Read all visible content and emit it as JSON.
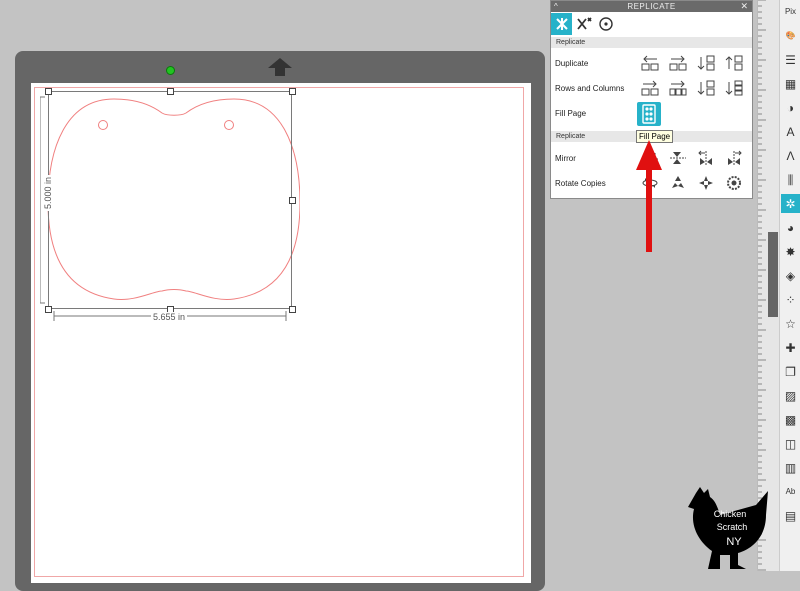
{
  "panel": {
    "title": "REPLICATE",
    "collapse_glyph": "^",
    "close_glyph": "✕",
    "tabs": [
      {
        "name": "replicate-icon",
        "active": true
      },
      {
        "name": "wand-icon",
        "active": false
      },
      {
        "name": "target-icon",
        "active": false
      }
    ],
    "section1": "Replicate",
    "section2": "Replicate",
    "rows": [
      {
        "label": "Duplicate"
      },
      {
        "label": "Rows and Columns"
      },
      {
        "label": "Fill Page"
      },
      {
        "label": "Mirror"
      },
      {
        "label": "Rotate Copies"
      }
    ],
    "tooltip": "Fill Page"
  },
  "selection": {
    "width_label": "5.655 in",
    "height_label": "5.000 in"
  },
  "toolbar": {
    "buttons": [
      {
        "name": "pix-icon",
        "glyph": "Pix"
      },
      {
        "name": "palette-icon",
        "glyph": "🎨"
      },
      {
        "name": "line-style-icon",
        "glyph": "☰"
      },
      {
        "name": "fill-pattern-icon",
        "glyph": "▦"
      },
      {
        "name": "transparency-icon",
        "glyph": "◑"
      },
      {
        "name": "text-icon",
        "glyph": "A"
      },
      {
        "name": "text-path-icon",
        "glyph": "Λ"
      },
      {
        "name": "align-icon",
        "glyph": "⫼"
      },
      {
        "name": "replicate-tool-icon",
        "glyph": "✲",
        "active": true
      },
      {
        "name": "transform-icon",
        "glyph": "◕"
      },
      {
        "name": "modify-icon",
        "glyph": "✸"
      },
      {
        "name": "offset-icon",
        "glyph": "◈"
      },
      {
        "name": "trace-icon",
        "glyph": "⁘"
      },
      {
        "name": "star-icon",
        "glyph": "☆"
      },
      {
        "name": "puzzle-icon",
        "glyph": "✚"
      },
      {
        "name": "layers-icon",
        "glyph": "❐"
      },
      {
        "name": "sketch-icon",
        "glyph": "▨"
      },
      {
        "name": "grid-icon",
        "glyph": "▩"
      },
      {
        "name": "3d-icon",
        "glyph": "◫"
      },
      {
        "name": "book-icon",
        "glyph": "▥"
      },
      {
        "name": "font-icon",
        "glyph": "Ab"
      },
      {
        "name": "library-icon",
        "glyph": "▤"
      }
    ]
  },
  "logo": {
    "line1": "Chicken",
    "line2": "Scratch",
    "line3": "NY"
  },
  "colors": {
    "accent": "#26b2c9",
    "arrow": "#e01010",
    "cut_line": "#f08080"
  }
}
